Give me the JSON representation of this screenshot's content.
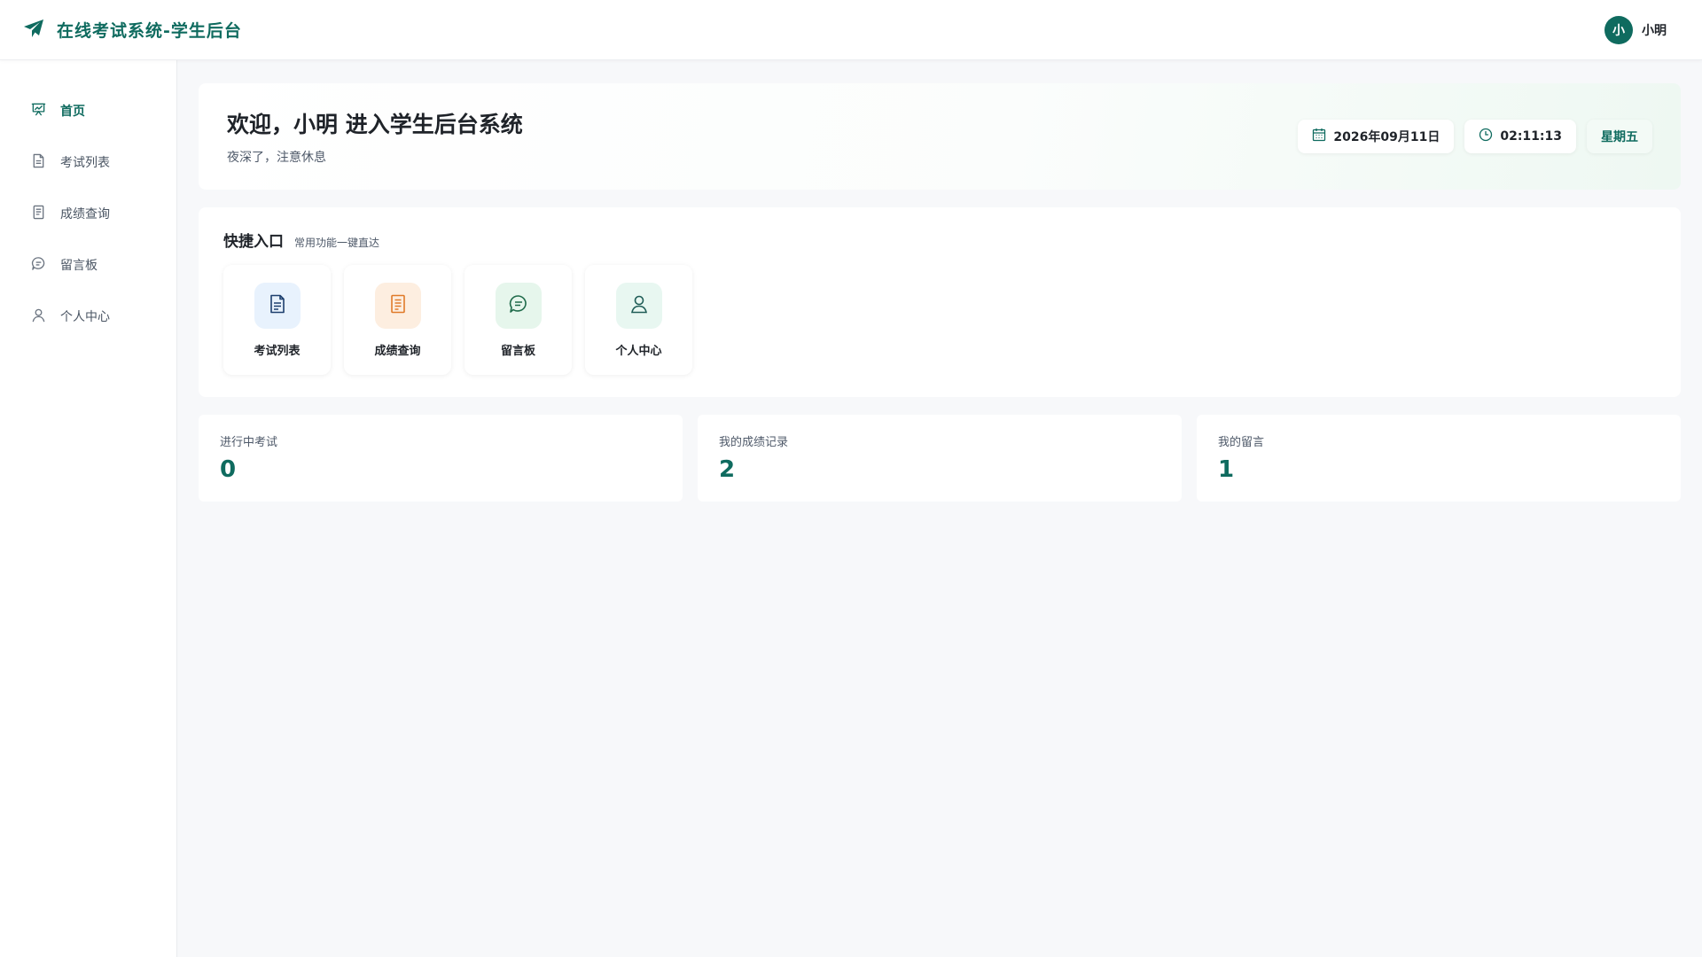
{
  "header": {
    "brand_icon": "paper-plane-icon",
    "title": "在线考试系统-学生后台",
    "user": {
      "avatar_initial": "小",
      "name": "小明"
    }
  },
  "sidebar": {
    "items": [
      {
        "label": "首页",
        "icon": "presentation-chart-icon",
        "active": true
      },
      {
        "label": "考试列表",
        "icon": "document-icon",
        "active": false
      },
      {
        "label": "成绩查询",
        "icon": "list-document-icon",
        "active": false
      },
      {
        "label": "留言板",
        "icon": "chat-bubble-icon",
        "active": false
      },
      {
        "label": "个人中心",
        "icon": "user-icon",
        "active": false
      }
    ]
  },
  "welcome": {
    "title": "欢迎，小明 进入学生后台系统",
    "subtitle": "夜深了，注意休息",
    "date": "2026年09月11日",
    "time": "02:11:13",
    "weekday": "星期五"
  },
  "quick_entry": {
    "title": "快捷入口",
    "subtitle": "常用功能一键直达",
    "cards": [
      {
        "label": "考试列表",
        "icon": "document-icon",
        "bg": "#e8f2fd",
        "color": "#1d3f6e"
      },
      {
        "label": "成绩查询",
        "icon": "list-document-icon",
        "bg": "#fdeee0",
        "color": "#e07b2a"
      },
      {
        "label": "留言板",
        "icon": "chat-bubble-icon",
        "bg": "#e6f6ec",
        "color": "#1f6b4a"
      },
      {
        "label": "个人中心",
        "icon": "user-icon",
        "bg": "#e8f7f1",
        "color": "#1f5d57"
      }
    ]
  },
  "stats": [
    {
      "label": "进行中考试",
      "value": "0"
    },
    {
      "label": "我的成绩记录",
      "value": "2"
    },
    {
      "label": "我的留言",
      "value": "1"
    }
  ],
  "colors": {
    "accent": "#0f6b5f",
    "background": "#f7f8fa"
  }
}
